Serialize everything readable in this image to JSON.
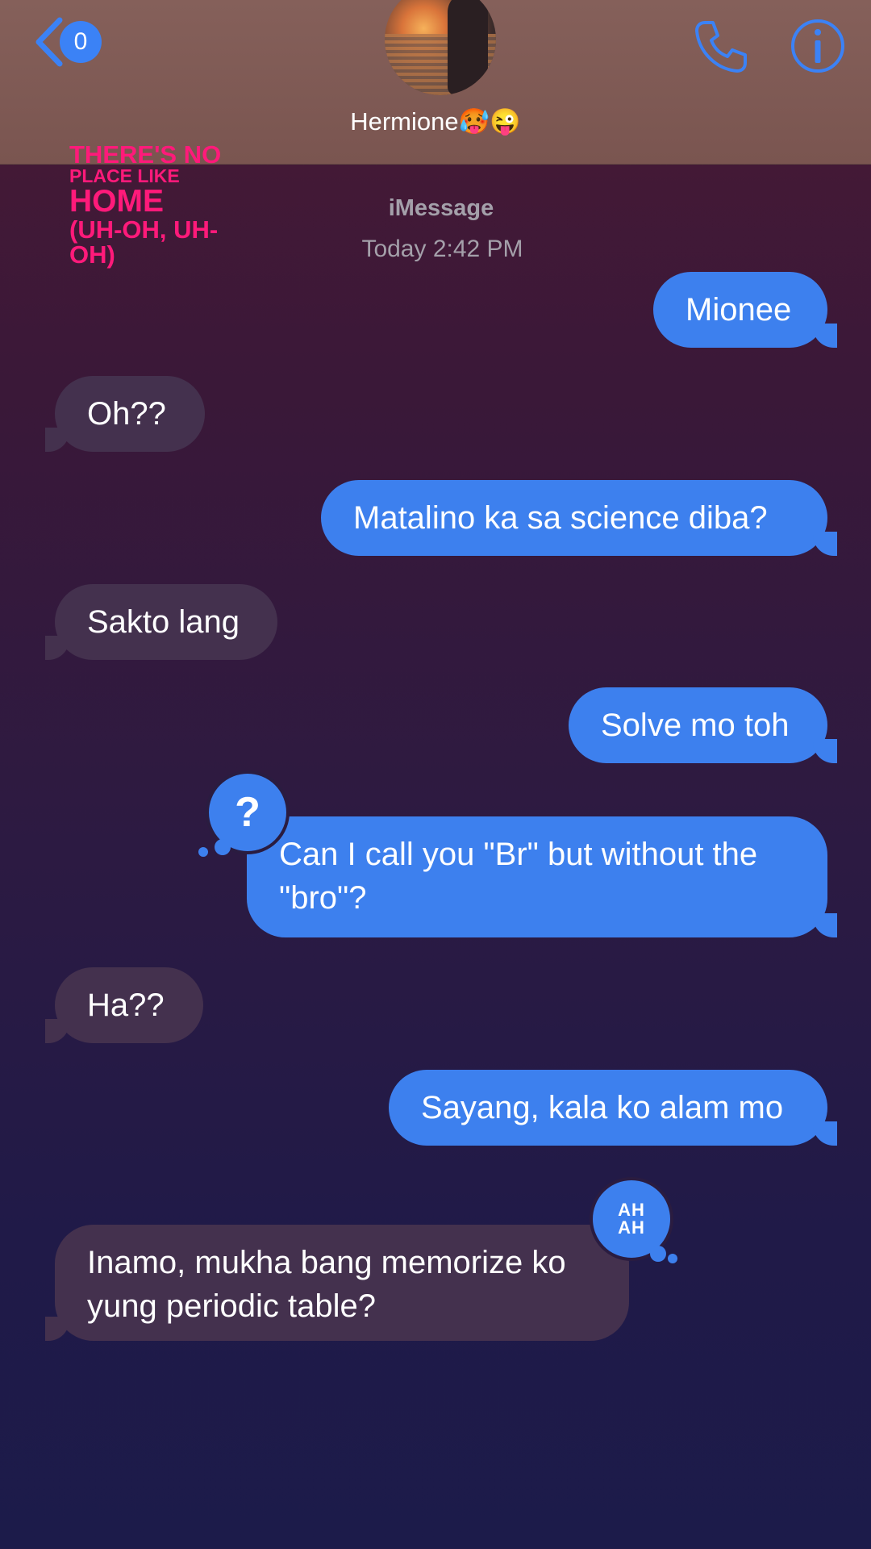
{
  "header": {
    "back_count": "0",
    "contact_name": "Hermione🥵😜",
    "accent_color": "#3b82f6"
  },
  "lyric_sticker": {
    "line1": "THERE'S NO",
    "line2": "PLACE LIKE",
    "line3": "HOME",
    "line4": "(UH-OH, UH-",
    "line5": "OH)",
    "color": "#ff1a7a"
  },
  "conversation": {
    "service": "iMessage",
    "timestamp": "Today 2:42 PM",
    "messages": [
      {
        "direction": "outgoing",
        "text": "Mionee"
      },
      {
        "direction": "incoming",
        "text": "Oh??"
      },
      {
        "direction": "outgoing",
        "text": "Matalino ka sa science diba?"
      },
      {
        "direction": "incoming",
        "text": "Sakto lang"
      },
      {
        "direction": "outgoing",
        "text": "Solve mo toh"
      },
      {
        "direction": "outgoing",
        "text": "Can I call you \"Br\" but without the \"bro\"?",
        "tapback": "?"
      },
      {
        "direction": "incoming",
        "text": "Ha??"
      },
      {
        "direction": "outgoing",
        "text": "Sayang, kala ko alam mo"
      },
      {
        "direction": "incoming",
        "text": "Inamo, mukha bang memorize ko yung periodic table?",
        "tapback": "AH AH"
      }
    ]
  },
  "tapbacks": {
    "question": "?",
    "haha_top": "AH",
    "haha_bottom": "AH"
  },
  "icons": [
    "chevron-left-icon",
    "phone-icon",
    "info-icon"
  ]
}
